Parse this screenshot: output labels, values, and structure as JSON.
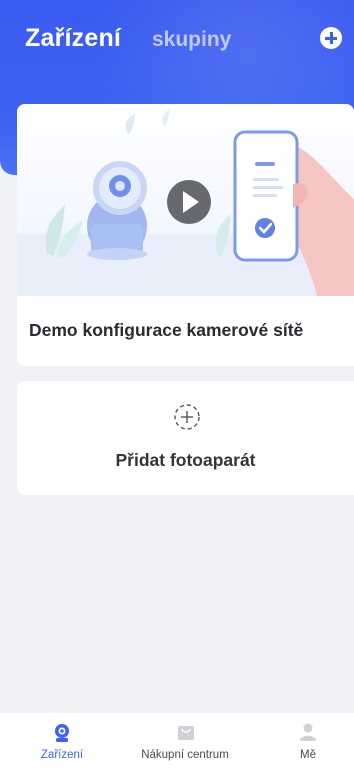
{
  "header": {
    "tab_active": "Zařízení",
    "tab_inactive": "skupiny",
    "add_icon": "plus-circle-icon"
  },
  "demo_card": {
    "title": "Demo konfigurace kamerové sítě",
    "play_icon": "play-icon"
  },
  "add_card": {
    "label": "Přidat fotoaparát",
    "icon": "dashed-plus-circle-icon"
  },
  "bottom_nav": {
    "items": [
      {
        "label": "Zařízení",
        "icon": "camera-icon",
        "active": true
      },
      {
        "label": "Nákupní centrum",
        "icon": "shopping-bag-icon",
        "active": false
      },
      {
        "label": "Mě",
        "icon": "person-icon",
        "active": false
      }
    ]
  },
  "colors": {
    "accent": "#3d63f2",
    "background": "#f1f2f6",
    "card": "#ffffff",
    "text": "#2b2b33"
  }
}
